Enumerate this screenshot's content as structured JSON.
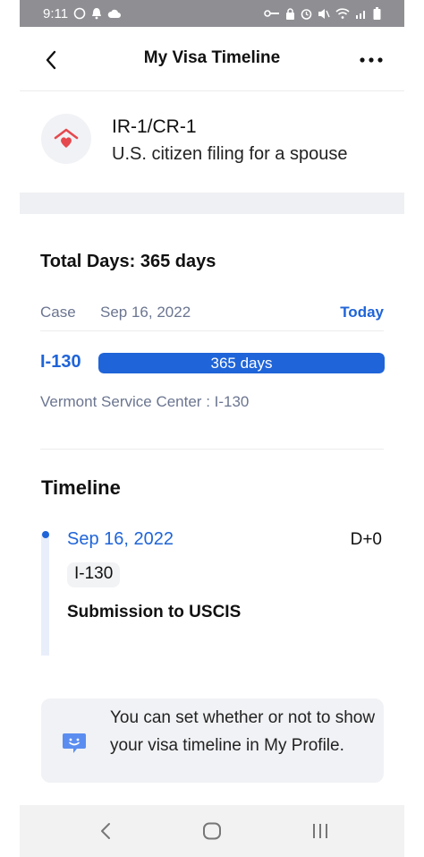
{
  "status_bar": {
    "time": "9:11"
  },
  "header": {
    "title": "My Visa Timeline",
    "back_icon": "chevron-left-icon",
    "more_icon": "more-horizontal-icon"
  },
  "visa": {
    "type": "IR-1/CR-1",
    "description": "U.S. citizen filing for a spouse",
    "icon": "house-heart-icon",
    "icon_color": "#e5484d"
  },
  "summary": {
    "total_days_label": "Total Days: 365 days",
    "case_label": "Case",
    "case_date": "Sep 16, 2022",
    "today_label": "Today",
    "form": "I-130",
    "progress_text": "365 days",
    "progress_fraction": 1.0,
    "service_center": "Vermont Service Center : I-130"
  },
  "timeline": {
    "title": "Timeline",
    "events": [
      {
        "date": "Sep 16, 2022",
        "day": "D+0",
        "tag": "I-130",
        "title": "Submission to USCIS"
      }
    ]
  },
  "info_note": {
    "text": "You can set whether or not to show your visa timeline in My Profile.",
    "icon": "chat-smile-icon"
  },
  "colors": {
    "accent": "#1f64d8",
    "muted_text": "#6b7590",
    "band": "#eff0f3"
  }
}
